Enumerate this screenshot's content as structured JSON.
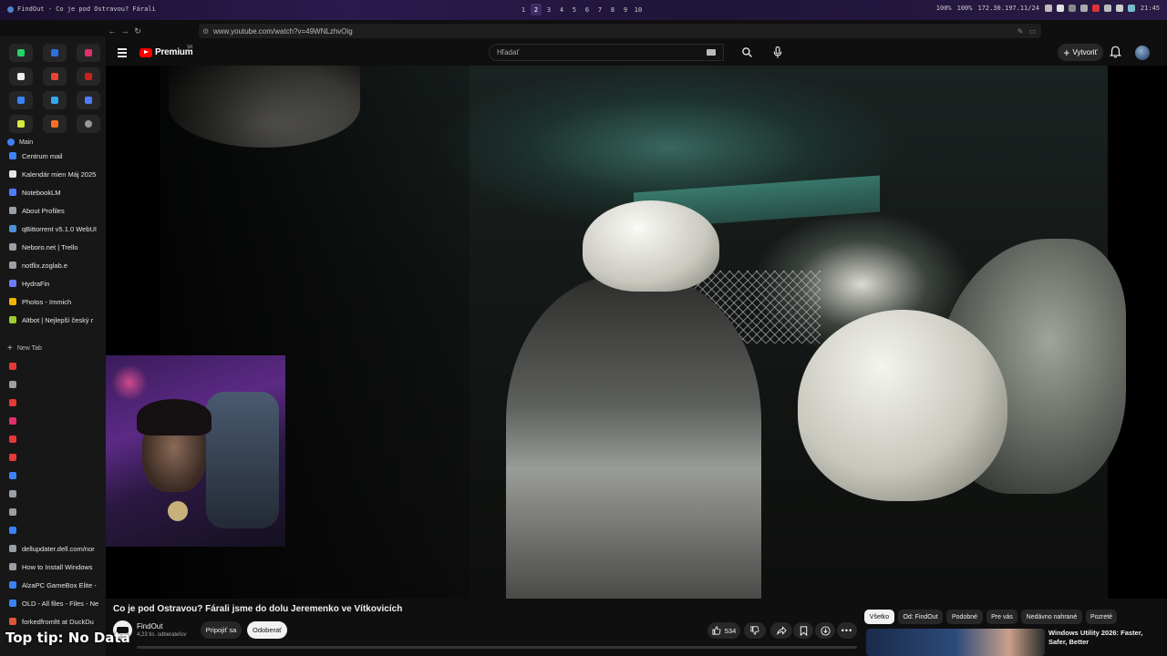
{
  "system_bar": {
    "window_title": "FindOut - Co je pod Ostravou? Fárali",
    "workspaces": [
      "1",
      "2",
      "3",
      "4",
      "5",
      "6",
      "7",
      "8",
      "9",
      "10"
    ],
    "active_workspace": "2",
    "volume": "100%",
    "brightness": "100%",
    "ip": "172.30.197.11/24",
    "clock": "21:45"
  },
  "browser": {
    "url": "www.youtube.com/watch?v=49WNLzhvOig"
  },
  "sidebar": {
    "section_main": "Main",
    "items": [
      {
        "label": "Centrum mail",
        "color": "#3b82f6"
      },
      {
        "label": "Kalendár mien Máj 2025",
        "color": "#e5e5e5"
      },
      {
        "label": "NotebookLM",
        "color": "#4f7cff"
      },
      {
        "label": "About Profiles",
        "color": "#9aa0a6"
      },
      {
        "label": "qBittorrent v5.1.0 WebUI",
        "color": "#4a90d9"
      },
      {
        "label": "Neboro.net | Trello",
        "color": "#9aa0a6"
      },
      {
        "label": "notflix.zoglab.e",
        "color": "#9aa0a6"
      },
      {
        "label": "HydraFin",
        "color": "#6d7cff"
      },
      {
        "label": "Photos - Immich",
        "color": "#f3b400"
      },
      {
        "label": "Altbot | Nejlepší český r",
        "color": "#9acd32"
      }
    ],
    "new_tab": "New Tab",
    "lower_items": [
      {
        "label": "dellupdater.dell.com/nor",
        "color": "#9aa0a6"
      },
      {
        "label": "How to Install Windows",
        "color": "#9aa0a6"
      },
      {
        "label": "AlzaPC GameBox Elite - ",
        "color": "#3b82f6"
      },
      {
        "label": "OLD - All files - Files - Ne",
        "color": "#3b82f6"
      },
      {
        "label": "forkedfromltt at DuckDu",
        "color": "#de5833"
      }
    ]
  },
  "youtube": {
    "logo_text": "Premium",
    "country_code": "SK",
    "search_placeholder": "Hľadať",
    "create_label": "Vytvoriť",
    "video_title": "Co je pod Ostravou? Fárali jsme do dolu Jeremenko ve Vítkovicích",
    "channel_name": "FindOut",
    "channel_subs": "4,23 tis. odberateľov",
    "join_label": "Pripojiť sa",
    "subscribe_label": "Odoberať",
    "likes": "534",
    "chips": [
      "Všetko",
      "Od: FindOut",
      "Podobné",
      "Pre vás",
      "Nedávno nahrané",
      "Pozreté"
    ],
    "active_chip": "Všetko",
    "recommended_title": "Windows Utility 2026: Faster, Safer, Better"
  },
  "overlay": {
    "top_tip": "Top tip: No Data"
  },
  "colors": {
    "yt_red": "#ff0000",
    "bg": "#0f0f0f",
    "chip_bg": "#272727",
    "accent_purple": "#2b1a4d"
  }
}
